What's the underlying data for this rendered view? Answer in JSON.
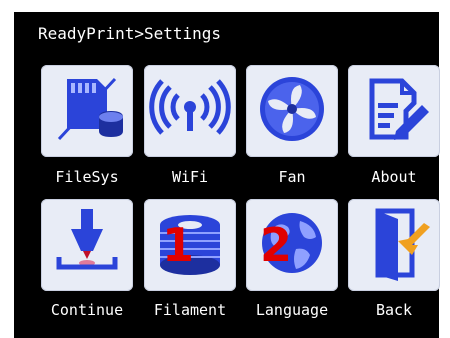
{
  "header": {
    "title": "ReadyPrint>Settings"
  },
  "tiles": [
    {
      "label": "FileSys",
      "icon": "sd-card-icon"
    },
    {
      "label": "WiFi",
      "icon": "wifi-icon"
    },
    {
      "label": "Fan",
      "icon": "fan-icon"
    },
    {
      "label": "About",
      "icon": "document-edit-icon"
    },
    {
      "label": "Continue",
      "icon": "print-nozzle-icon"
    },
    {
      "label": "Filament",
      "icon": "filament-spool-icon"
    },
    {
      "label": "Language",
      "icon": "globe-icon"
    },
    {
      "label": "Back",
      "icon": "exit-door-icon"
    }
  ],
  "annotations": [
    "1",
    "2"
  ],
  "colors": {
    "screen": "#000000",
    "tile": "#e8ecf6",
    "icon_blue": "#2b44d9",
    "annotation": "#e00000"
  }
}
